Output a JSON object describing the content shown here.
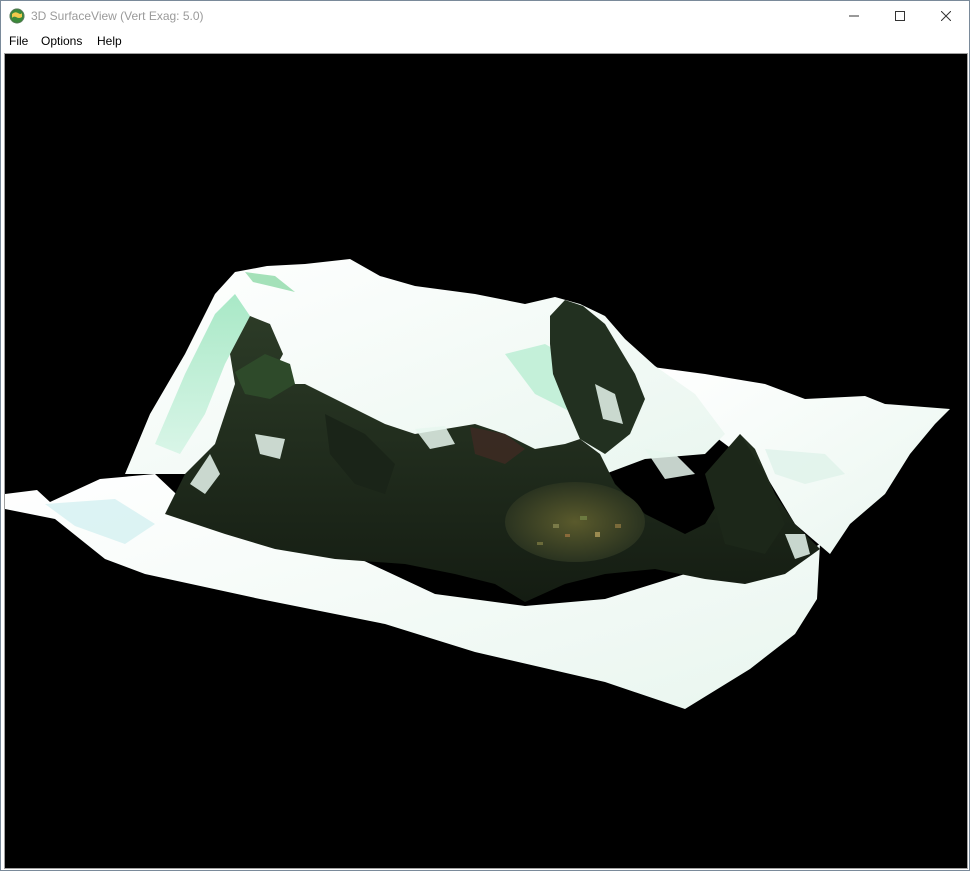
{
  "window": {
    "title": "3D SurfaceView (Vert Exag: 5.0)",
    "app_icon": "globe-app-icon"
  },
  "title_buttons": {
    "minimize_icon": "minimize-icon",
    "maximize_icon": "maximize-icon",
    "close_icon": "close-icon"
  },
  "menu": {
    "file": "File",
    "options": "Options",
    "help": "Help"
  },
  "viewport": {
    "background": "#000000",
    "content": "3D terrain surface rendering"
  },
  "colors": {
    "terrain_dark": "#1f2b1c",
    "terrain_mid": "#2f4a2c",
    "terrain_green": "#8fe0b0",
    "terrain_snow": "#f4faf6"
  }
}
